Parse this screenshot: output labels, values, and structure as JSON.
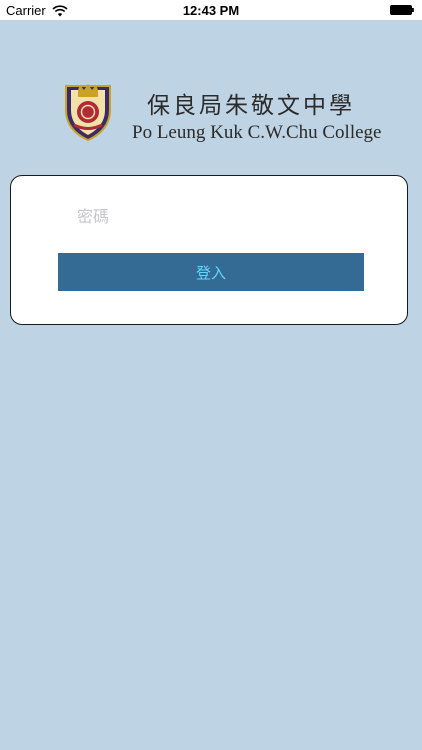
{
  "status_bar": {
    "carrier": "Carrier",
    "time": "12:43 PM",
    "wifi_icon": "wifi-icon",
    "battery_icon": "battery-full-icon"
  },
  "header": {
    "logo_icon": "school-crest-icon",
    "school_name_zh": "保良局朱敬文中學",
    "school_name_en": "Po Leung Kuk C.W.Chu College"
  },
  "login": {
    "password_placeholder": "密碼",
    "password_value": "",
    "submit_label": "登入"
  },
  "colors": {
    "background": "#bed3e3",
    "button": "#346b95",
    "button_text": "#61d7ff",
    "card": "#ffffff"
  }
}
